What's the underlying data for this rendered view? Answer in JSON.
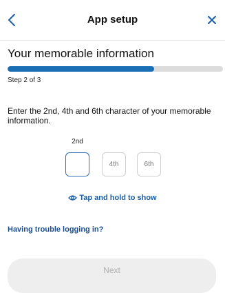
{
  "header": {
    "title": "App setup",
    "back_icon": "chevron-left-icon",
    "close_icon": "close-icon"
  },
  "page": {
    "title": "Your memorable information",
    "progress_fraction": 0.68,
    "step_label": "Step 2 of 3"
  },
  "instructions": "Enter the 2nd, 4th and 6th character of your memorable information.",
  "char_boxes": [
    {
      "caption": "2nd",
      "placeholder": "",
      "state": "active"
    },
    {
      "caption": "",
      "placeholder": "4th",
      "state": "inactive"
    },
    {
      "caption": "",
      "placeholder": "6th",
      "state": "inactive"
    }
  ],
  "tap_and_hold": {
    "label": "Tap and hold to show",
    "icon": "eye-icon"
  },
  "trouble_link": "Having trouble logging in?",
  "next_button": "Next",
  "colors": {
    "accent": "#1a6fb5",
    "link": "#1a5ea6",
    "progress_track": "#dcdcdc",
    "button_disabled_bg": "#eeeeee"
  }
}
